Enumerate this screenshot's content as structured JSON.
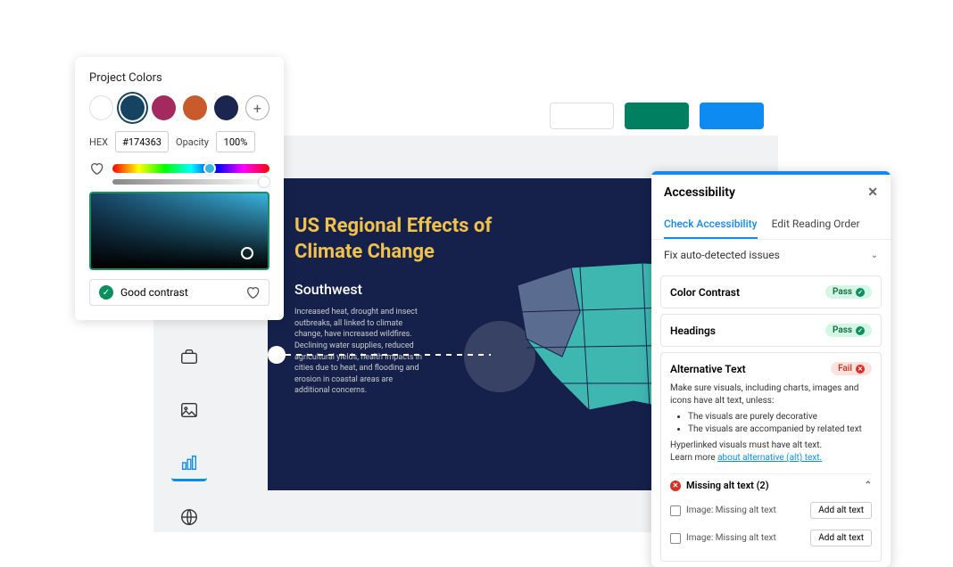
{
  "color_panel": {
    "title": "Project Colors",
    "swatches": [
      "#ffffff",
      "#174363",
      "#a3295f",
      "#c85a2c",
      "#1a2550"
    ],
    "selected_index": 1,
    "hex_label": "HEX",
    "hex_value": "#174363",
    "opacity_label": "Opacity",
    "opacity_value": "100%",
    "contrast_label": "Good contrast"
  },
  "canvas": {
    "title_line1": "US Regional Effects of",
    "title_line2": "Climate Change",
    "subtitle": "Southwest",
    "body": "Increased heat, drought and insect outbreaks, all linked to climate change, have increased wildfires. Declining water supplies, reduced agricultural yields, health impacts in cities due to heat, and flooding and erosion in coastal areas are additional concerns."
  },
  "accessibility": {
    "title": "Accessibility",
    "tab_check": "Check Accessibility",
    "tab_order": "Edit Reading Order",
    "fix_header": "Fix auto-detected issues",
    "checks": {
      "contrast": {
        "label": "Color Contrast",
        "status": "Pass"
      },
      "headings": {
        "label": "Headings",
        "status": "Pass"
      },
      "alt": {
        "label": "Alternative Text",
        "status": "Fail",
        "desc_intro": "Make sure visuals, including charts, images and icons have alt text, unless:",
        "bullet1": "The visuals are purely decorative",
        "bullet2": "The visuals are accompanied by related text",
        "desc_hyperlink": "Hyperlinked visuals must have alt text.",
        "learn_prefix": "Learn more ",
        "learn_link": "about alternative (alt) text.",
        "missing_header": "Missing alt text (2)",
        "item_label": "Image: Missing alt text",
        "add_button": "Add alt text"
      }
    }
  }
}
